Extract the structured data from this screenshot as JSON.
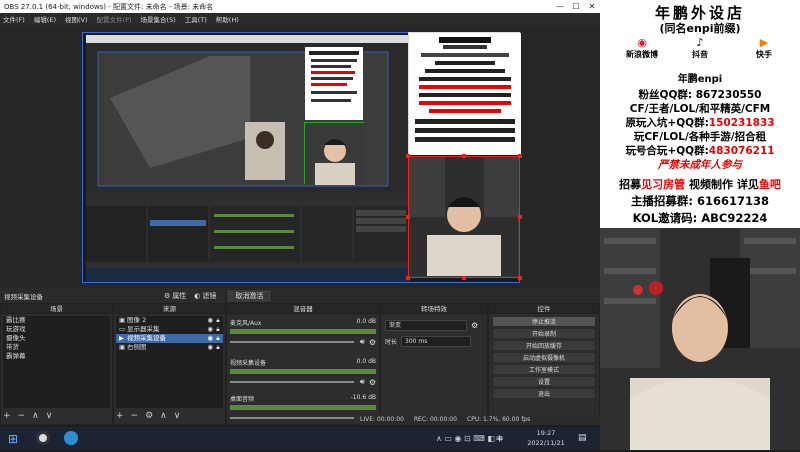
{
  "window": {
    "title": "OBS 27.0.1 (64-bit, windows) - 配置文件: 未命名 - 场景: 未命名",
    "controls": [
      "—",
      "☐",
      "✕"
    ]
  },
  "menu": {
    "items": [
      "文件(F)",
      "编辑(E)",
      "视图(V)",
      "配置文件(P)",
      "场景集合(S)",
      "工具(T)",
      "帮助(H)"
    ]
  },
  "overlay": {
    "title": "年鹏外设店",
    "subtitle": "(同名enpi前缀)",
    "platforms": [
      "新浪微博",
      "抖音",
      "快手"
    ],
    "handle": "年鹏enpi",
    "fans_qq": "粉丝QQ群: 867230550",
    "games_line": "CF/王者/LOL/和平精英/CFM",
    "play_group_label": "原玩入坑+QQ群:",
    "play_group_value": "150231833",
    "play_group2_label": "玩CF/LOL/各种手游/招合租",
    "play_group3_label": "玩号合玩+QQ群:",
    "play_group3_value": "483076211",
    "minors": "严禁未成年人参与",
    "recruit_prefix": "招募",
    "recruit_1": "见习房管",
    "recruit_2": "视频制作",
    "recruit_mid": "详见",
    "recruit_3": "鱼吧",
    "anchor_label": "主播招募群: 616617138",
    "kol_label": "KOL邀请码: ABC92224"
  },
  "source_bar": {
    "current_source": "视频采集设备",
    "properties_label": "属性",
    "filters_label": "滤镜",
    "deactivate_label": "取消激活"
  },
  "docks": {
    "scenes": {
      "title": "场景",
      "items": [
        "霸比赛",
        "玩游戏",
        "摄像头",
        "带货",
        "霸弹幕"
      ]
    },
    "sources": {
      "title": "来源",
      "items": [
        "图像 2",
        "显示器采集",
        "视频采集设备",
        "右侧图"
      ]
    },
    "mixer": {
      "title": "混音器",
      "tracks": [
        {
          "name": "麦克风/Aux",
          "db": "0.0 dB"
        },
        {
          "name": "视频采集设备",
          "db": "0.0 dB"
        },
        {
          "name": "桌面音频",
          "db": "-10.6 dB"
        }
      ]
    },
    "transitions": {
      "title": "转场特效",
      "type": "渐变",
      "duration_label": "时长",
      "duration_value": "300 ms"
    },
    "controls": {
      "title": "控件",
      "buttons": [
        "停止推流",
        "开始录制",
        "开始回放缓存",
        "启动虚拟摄像机",
        "工作室模式",
        "设置",
        "退出"
      ]
    }
  },
  "status": {
    "live": "LIVE: 00:00:00",
    "rec": "REC: 00:00:00",
    "cpu": "CPU: 1.7%, 60.00 fps"
  },
  "taskbar": {
    "time": "19:27",
    "date": "2022/11/21",
    "ime": "中"
  },
  "colors": {
    "obs_bg": "#2d2d2d",
    "selection_blue": "#3e6aa8",
    "overlay_red": "#e00000",
    "selection_red_border": "#e22222"
  }
}
